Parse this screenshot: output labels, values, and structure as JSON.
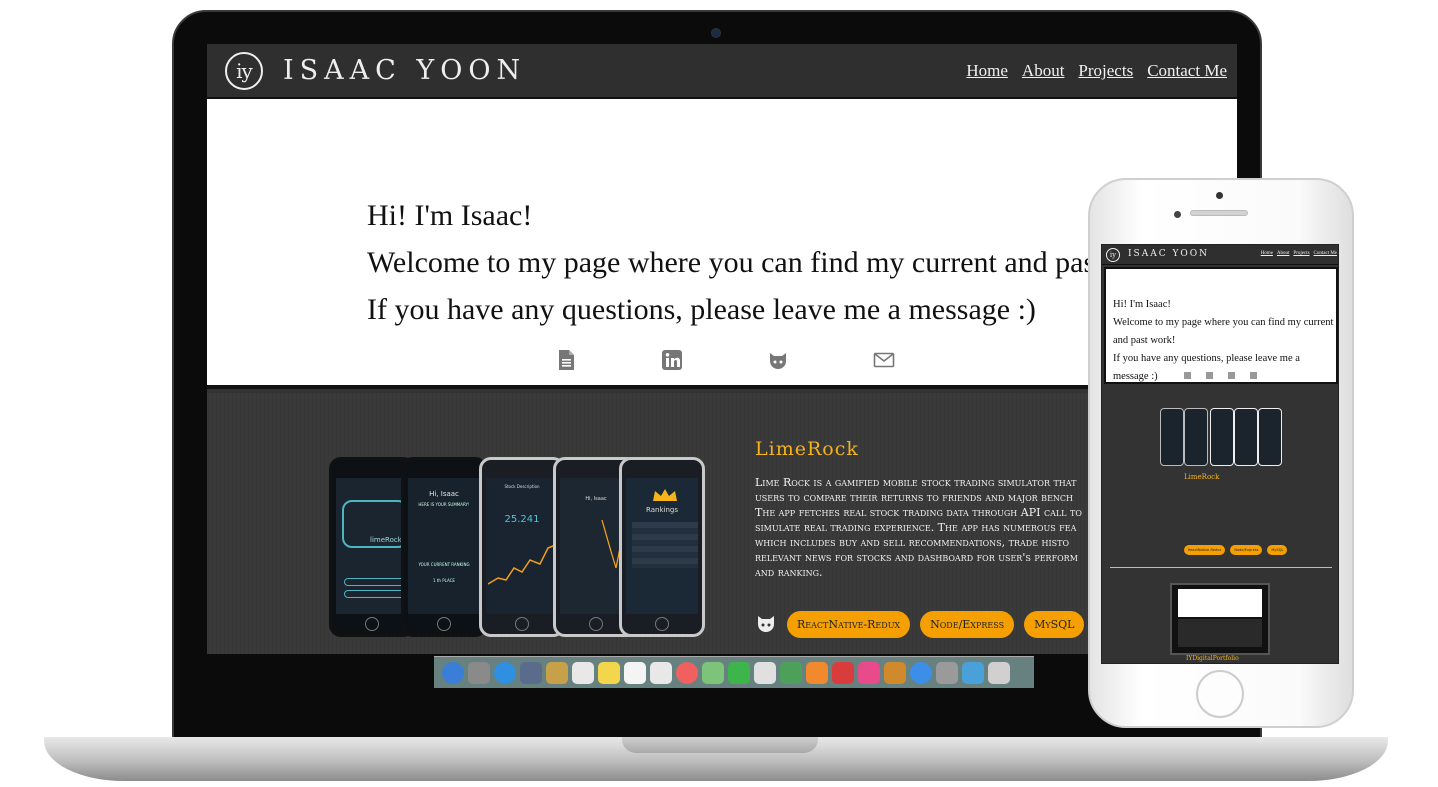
{
  "laptop": {
    "header": {
      "logo_text": "iy",
      "site_name": "ISAAC YOON",
      "nav": [
        {
          "label": "Home"
        },
        {
          "label": "About"
        },
        {
          "label": "Projects"
        },
        {
          "label": "Contact Me"
        }
      ]
    },
    "hero": {
      "lines": [
        "Hi! I'm Isaac!",
        "Welcome to my page where you can find my current and past work!",
        "If you have any questions, please leave me a message :)"
      ],
      "icons": [
        "document-icon",
        "linkedin-icon",
        "github-icon",
        "mail-icon"
      ]
    },
    "project": {
      "title": "LimeRock",
      "description_lines": [
        "Lime Rock is a gamified mobile stock trading simulator that",
        "users to compare their returns to friends and major bench",
        "The app fetches real stock trading data through API call to",
        "simulate real trading experience. The app has numerous fea",
        "which includes buy and sell recommendations, trade histo",
        "relevant news for stocks and dashboard for user's perform",
        "and ranking."
      ],
      "tags": [
        "ReactNative-Redux",
        "Node/Express",
        "MySQL"
      ],
      "phone_screens": {
        "screen_1_label": "limeRock",
        "screen_2_greeting": "Hi, Isaac",
        "screen_2_summary": "HERE IS YOUR SUMMARY!",
        "screen_2_ranking": "YOUR CURRENT RANKING",
        "screen_2_place": "1 th PLACE",
        "screen_3_title": "Stock Description",
        "screen_3_value": "25.241",
        "screen_4_greeting": "Hi, Isaac",
        "screen_5_title": "Rankings"
      }
    },
    "dock_colors": [
      "#3b7ed8",
      "#8a8a8a",
      "#2f8fe0",
      "#5a6b8c",
      "#c7a04a",
      "#e8e8e8",
      "#f2d64b",
      "#f4f4f4",
      "#e8e8e8",
      "#f06060",
      "#7ec37a",
      "#3db54a",
      "#e0e0e0",
      "#4ca05a",
      "#f08a2c",
      "#d93c3c",
      "#e84a8a",
      "#d08a2c",
      "#3c8ee8",
      "#9a9a9a",
      "#4aa0d8",
      "#d0d0d0"
    ]
  },
  "phone": {
    "header": {
      "logo_text": "iy",
      "site_name": "ISAAC YOON",
      "nav": [
        "Home",
        "About",
        "Projects",
        "Contact Me"
      ]
    },
    "hero": {
      "lines": [
        "Hi! I'm Isaac!",
        "Welcome to my page where you can find my current",
        "and past work!",
        "If you have any questions, please leave me a message :)"
      ]
    },
    "project": {
      "title": "LimeRock",
      "tags": [
        "ReactNative-Redux",
        "Node/Express",
        "MySQL"
      ],
      "next_title": "IYDigitalPortfolio"
    }
  }
}
